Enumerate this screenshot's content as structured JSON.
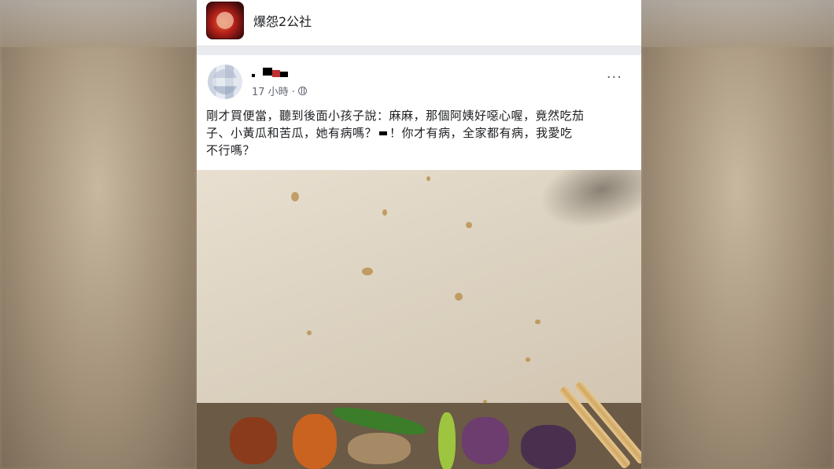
{
  "group": {
    "name": "爆怨2公社",
    "avatar_icon": "group-logo-icon"
  },
  "post": {
    "author_name": "",
    "timestamp": "17 小時 ·",
    "privacy_icon": "globe-icon",
    "more_label": "···",
    "text_line1": "剛才買便當，聽到後面小孩子說：麻麻，那個阿姨好噁心喔，竟然吃茄",
    "text_line2_a": "子、小黃瓜和苦瓜，她有病嗎？",
    "text_line2_b": "！你才有病，全家都有病，我愛吃",
    "text_line3": "不行嗎？",
    "photo_description_icon": "photo-image"
  },
  "colors": {
    "feed_bg": "#e9ebee",
    "text": "#1c1e21",
    "meta": "#616770"
  }
}
